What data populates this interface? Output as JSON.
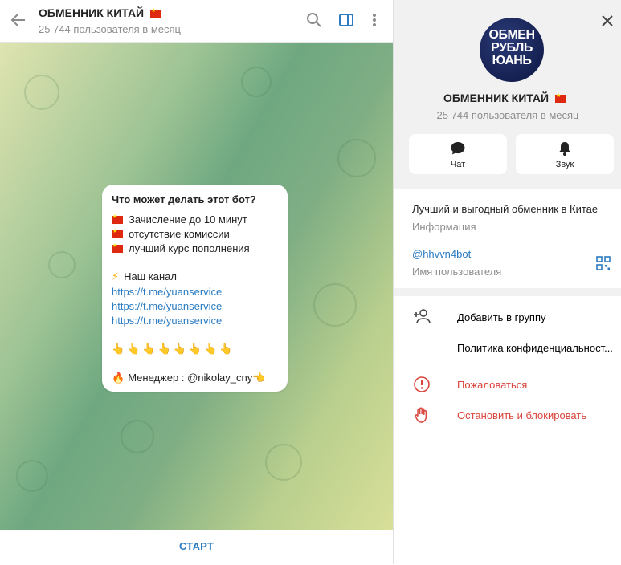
{
  "header": {
    "title": "ОБМЕННИК КИТАЙ",
    "subtitle": "25 744 пользователя в месяц"
  },
  "message": {
    "heading": "Что может делать этот бот?",
    "features": [
      "Зачисление до 10 минут",
      "отсутствие комиссии",
      "лучший курс пополнения"
    ],
    "channel_label": "Наш канал",
    "links": [
      "https://t.me/yuanservice",
      "https://t.me/yuanservice",
      "https://t.me/yuanservice"
    ],
    "pointers": "👆👆👆👆👆👆👆👆",
    "manager": "Менеджер : @nikolay_cny"
  },
  "bottom": {
    "start_label": "СТАРТ"
  },
  "panel": {
    "avatar_text": [
      "ОБМЕН",
      "РУБЛЬ",
      "ЮАНЬ"
    ],
    "title": "ОБМЕННИК КИТАЙ",
    "subtitle": "25 744 пользователя в месяц",
    "actions": {
      "chat": "Чат",
      "sound": "Звук"
    },
    "description": "Лучший и выгодный обменник в Китае",
    "description_label": "Информация",
    "username": "@hhvvn4bot",
    "username_label": "Имя пользователя",
    "menu": {
      "add_to_group": "Добавить в группу",
      "privacy": "Политика конфиденциальност...",
      "report": "Пожаловаться",
      "block": "Остановить и блокировать"
    }
  },
  "colors": {
    "accent": "#2a7bc2",
    "danger": "#d9453c",
    "flag_red": "#de2910"
  }
}
